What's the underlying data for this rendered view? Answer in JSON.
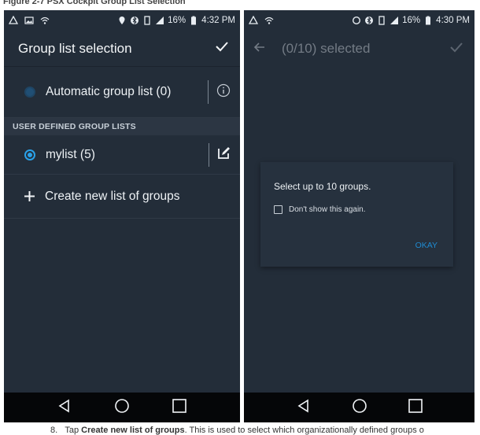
{
  "caption": "Figure 2-7 PSX Cockpit Group List Selection",
  "left_phone": {
    "status": {
      "battery": "16%",
      "time": "4:32 PM"
    },
    "title": "Group list selection",
    "automatic_row": "Automatic group list (0)",
    "section_header": "USER DEFINED GROUP LISTS",
    "mylist_row": "mylist (5)",
    "create_row": "Create new list of groups",
    "icons": [
      "check-icon",
      "info-icon",
      "edit-icon",
      "plus-icon"
    ]
  },
  "right_phone": {
    "status": {
      "battery": "16%",
      "time": "4:30 PM"
    },
    "title": "(0/10) selected",
    "dialog": {
      "message": "Select up to 10 groups.",
      "checkbox_label": "Don't show this again.",
      "ok_label": "OKAY"
    }
  },
  "footer": {
    "number": "8.",
    "prefix": "Tap ",
    "bold": "Create new list of groups",
    "suffix": ". This is used to select which organizationally defined groups o"
  },
  "colors": {
    "background": "#232d39",
    "accent": "#2aa1e8",
    "navbar": "#050608"
  }
}
